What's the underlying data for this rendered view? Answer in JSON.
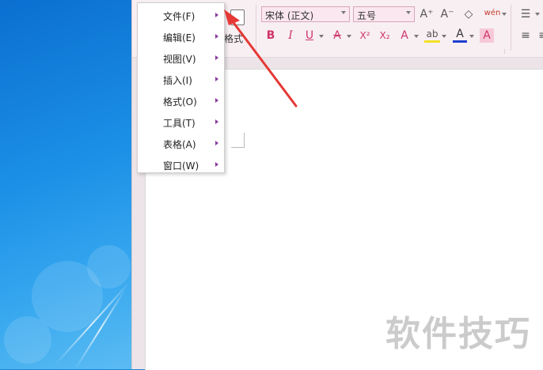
{
  "menu": {
    "items": [
      {
        "label": "文件(F)"
      },
      {
        "label": "编辑(E)"
      },
      {
        "label": "视图(V)"
      },
      {
        "label": "插入(I)"
      },
      {
        "label": "格式(O)"
      },
      {
        "label": "工具(T)"
      },
      {
        "label": "表格(A)"
      },
      {
        "label": "窗口(W)"
      }
    ]
  },
  "toolbar": {
    "paste_label": "格式",
    "font_name": "宋体 (正文)",
    "font_size": "五号",
    "bold": "B",
    "italic": "I",
    "underline": "U",
    "strikethrough": "A",
    "superscript": "X²",
    "subscript": "X₂",
    "text_effect": "A",
    "highlight": "ab",
    "font_color": "A",
    "char_shading": "A",
    "grow_font": "A⁺",
    "shrink_font": "A⁻",
    "clear_format": "◇",
    "phonetic": "wén"
  },
  "watermark": {
    "text": "软件技巧"
  },
  "colors": {
    "annotation_arrow": "#e53935",
    "menu_arrow": "#8a3a9f",
    "ribbon_select": "#fbe7ef"
  }
}
